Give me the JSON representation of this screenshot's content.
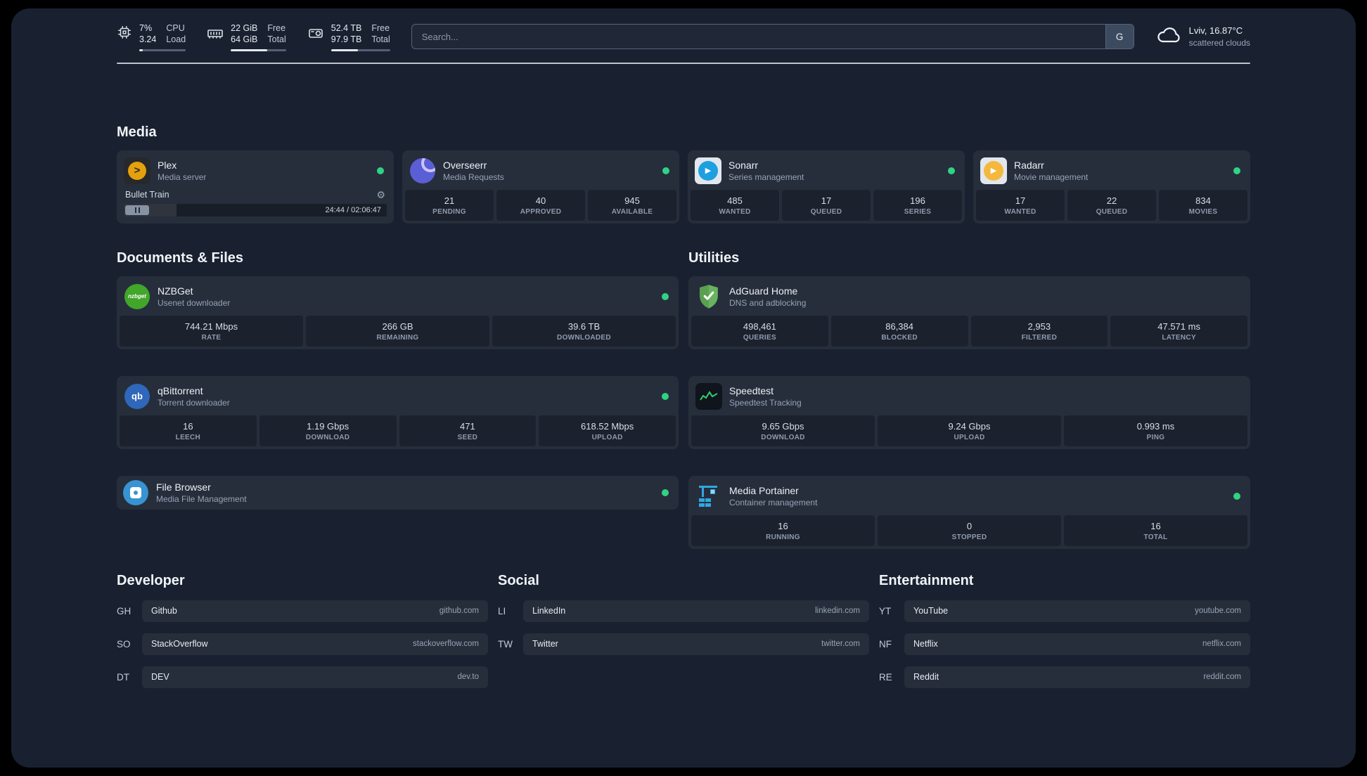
{
  "colors": {
    "status_green": "#2fd383",
    "plex_amber": "#e5a00d",
    "overseerr_purple": "#5a5fd6",
    "sonarr_blue": "#1e9fe0",
    "radarr_amber": "#f5b83d",
    "nzbget_green": "#41a62a",
    "qbittorrent_blue": "#2f67ba",
    "filebrowser_blue": "#3793d1",
    "adguard_green": "#68b35f",
    "speedtest_green": "#2dd36f",
    "portainer_blue": "#2fa8e0"
  },
  "topbar": {
    "cpu": {
      "value_top": "7%",
      "value_bottom": "3.24",
      "label_top": "CPU",
      "label_bottom": "Load",
      "bar_percent": 7
    },
    "memory": {
      "value_top": "22 GiB",
      "value_bottom": "64 GiB",
      "label_top": "Free",
      "label_bottom": "Total",
      "bar_percent": 66
    },
    "disk": {
      "value_top": "52.4 TB",
      "value_bottom": "97.9 TB",
      "label_top": "Free",
      "label_bottom": "Total",
      "bar_percent": 46
    },
    "search": {
      "placeholder": "Search...",
      "button_label": "G"
    },
    "weather": {
      "location": "Lviv, 16.87°C",
      "condition": "scattered clouds"
    }
  },
  "sections": {
    "media": {
      "title": "Media"
    },
    "documents": {
      "title": "Documents & Files"
    },
    "utilities": {
      "title": "Utilities"
    }
  },
  "services": {
    "plex": {
      "title": "Plex",
      "subtitle": "Media server",
      "player": {
        "track": "Bullet Train",
        "time": "24:44 / 02:06:47",
        "progress_percent": 20
      }
    },
    "overseerr": {
      "title": "Overseerr",
      "subtitle": "Media Requests",
      "stats": [
        {
          "value": "21",
          "label": "PENDING"
        },
        {
          "value": "40",
          "label": "APPROVED"
        },
        {
          "value": "945",
          "label": "AVAILABLE"
        }
      ]
    },
    "sonarr": {
      "title": "Sonarr",
      "subtitle": "Series management",
      "stats": [
        {
          "value": "485",
          "label": "WANTED"
        },
        {
          "value": "17",
          "label": "QUEUED"
        },
        {
          "value": "196",
          "label": "SERIES"
        }
      ]
    },
    "radarr": {
      "title": "Radarr",
      "subtitle": "Movie management",
      "stats": [
        {
          "value": "17",
          "label": "WANTED"
        },
        {
          "value": "22",
          "label": "QUEUED"
        },
        {
          "value": "834",
          "label": "MOVIES"
        }
      ]
    },
    "nzbget": {
      "title": "NZBGet",
      "subtitle": "Usenet downloader",
      "icon_text": "nzbget",
      "stats": [
        {
          "value": "744.21 Mbps",
          "label": "RATE"
        },
        {
          "value": "266 GB",
          "label": "REMAINING"
        },
        {
          "value": "39.6 TB",
          "label": "DOWNLOADED"
        }
      ]
    },
    "qbittorrent": {
      "title": "qBittorrent",
      "subtitle": "Torrent downloader",
      "icon_text": "qb",
      "stats": [
        {
          "value": "16",
          "label": "LEECH"
        },
        {
          "value": "1.19 Gbps",
          "label": "DOWNLOAD"
        },
        {
          "value": "471",
          "label": "SEED"
        },
        {
          "value": "618.52 Mbps",
          "label": "UPLOAD"
        }
      ]
    },
    "filebrowser": {
      "title": "File Browser",
      "subtitle": "Media File Management"
    },
    "adguard": {
      "title": "AdGuard Home",
      "subtitle": "DNS and adblocking",
      "stats": [
        {
          "value": "498,461",
          "label": "QUERIES"
        },
        {
          "value": "86,384",
          "label": "BLOCKED"
        },
        {
          "value": "2,953",
          "label": "FILTERED"
        },
        {
          "value": "47.571 ms",
          "label": "LATENCY"
        }
      ]
    },
    "speedtest": {
      "title": "Speedtest",
      "subtitle": "Speedtest Tracking",
      "stats": [
        {
          "value": "9.65 Gbps",
          "label": "DOWNLOAD"
        },
        {
          "value": "9.24 Gbps",
          "label": "UPLOAD"
        },
        {
          "value": "0.993 ms",
          "label": "PING"
        }
      ]
    },
    "portainer": {
      "title": "Media Portainer",
      "subtitle": "Container management",
      "stats": [
        {
          "value": "16",
          "label": "RUNNING"
        },
        {
          "value": "0",
          "label": "STOPPED"
        },
        {
          "value": "16",
          "label": "TOTAL"
        }
      ]
    }
  },
  "bookmarks": {
    "developer": {
      "title": "Developer",
      "items": [
        {
          "abbr": "GH",
          "name": "Github",
          "domain": "github.com"
        },
        {
          "abbr": "SO",
          "name": "StackOverflow",
          "domain": "stackoverflow.com"
        },
        {
          "abbr": "DT",
          "name": "DEV",
          "domain": "dev.to"
        }
      ]
    },
    "social": {
      "title": "Social",
      "items": [
        {
          "abbr": "LI",
          "name": "LinkedIn",
          "domain": "linkedin.com"
        },
        {
          "abbr": "TW",
          "name": "Twitter",
          "domain": "twitter.com"
        }
      ]
    },
    "entertainment": {
      "title": "Entertainment",
      "items": [
        {
          "abbr": "YT",
          "name": "YouTube",
          "domain": "youtube.com"
        },
        {
          "abbr": "NF",
          "name": "Netflix",
          "domain": "netflix.com"
        },
        {
          "abbr": "RE",
          "name": "Reddit",
          "domain": "reddit.com"
        }
      ]
    }
  }
}
